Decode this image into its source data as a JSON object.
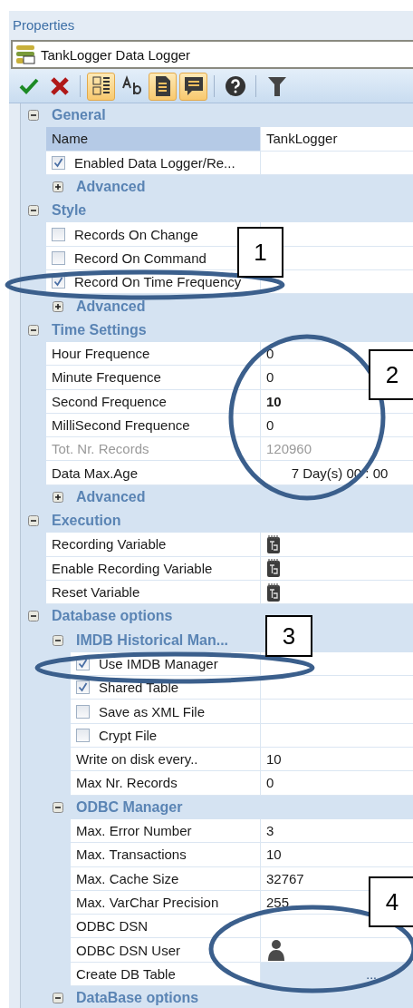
{
  "panel": {
    "title": "Properties"
  },
  "object_selector": {
    "value": "TankLogger Data Logger"
  },
  "toolbar": [
    {
      "kind": "apply",
      "selected": false
    },
    {
      "kind": "cancel",
      "selected": false
    },
    {
      "kind": "separator"
    },
    {
      "kind": "categorized",
      "selected": true
    },
    {
      "kind": "alphabetical",
      "selected": false
    },
    {
      "kind": "pages",
      "selected": true
    },
    {
      "kind": "comments",
      "selected": true
    },
    {
      "kind": "separator"
    },
    {
      "kind": "help",
      "selected": false
    },
    {
      "kind": "separator"
    },
    {
      "kind": "filter",
      "selected": false
    }
  ],
  "grid": [
    {
      "kind": "group",
      "label": "General",
      "expanded": true,
      "children": [
        {
          "kind": "text",
          "label": "Name",
          "value": "TankLogger",
          "selected": true,
          "disabled": false
        },
        {
          "kind": "check",
          "label": "Enabled Data Logger/Re...",
          "checked": true
        },
        {
          "kind": "group",
          "label": "Advanced",
          "expanded": false
        }
      ]
    },
    {
      "kind": "group",
      "label": "Style",
      "expanded": true,
      "children": [
        {
          "kind": "check",
          "label": "Records On Change",
          "checked": false
        },
        {
          "kind": "check",
          "label": "Record On Command",
          "checked": false
        },
        {
          "kind": "check",
          "label": "Record On Time Frequency",
          "checked": true
        },
        {
          "kind": "group",
          "label": "Advanced",
          "expanded": false
        }
      ]
    },
    {
      "kind": "group",
      "label": "Time Settings",
      "expanded": true,
      "children": [
        {
          "kind": "text",
          "label": "Hour Frequence",
          "value": "0",
          "selected": false,
          "disabled": false
        },
        {
          "kind": "text",
          "label": "Minute Frequence",
          "value": "0",
          "selected": false,
          "disabled": false
        },
        {
          "kind": "text",
          "label": "Second Frequence",
          "value": "10",
          "selected": false,
          "disabled": false,
          "modified": true
        },
        {
          "kind": "text",
          "label": "MilliSecond Frequence",
          "value": "0",
          "selected": false,
          "disabled": false
        },
        {
          "kind": "text",
          "label": "Tot. Nr. Records",
          "value": "120960",
          "selected": false,
          "disabled": true
        },
        {
          "kind": "duration",
          "label": "Data Max.Age",
          "value": "7 Day(s) 00 : 00"
        },
        {
          "kind": "group",
          "label": "Advanced",
          "expanded": false
        }
      ]
    },
    {
      "kind": "group",
      "label": "Execution",
      "expanded": true,
      "children": [
        {
          "kind": "variable",
          "label": "Recording Variable"
        },
        {
          "kind": "variable",
          "label": "Enable Recording Variable"
        },
        {
          "kind": "variable",
          "label": "Reset Variable"
        }
      ]
    },
    {
      "kind": "group",
      "label": "Database options",
      "expanded": true,
      "children": [
        {
          "kind": "group",
          "label": "IMDB Historical Man...",
          "expanded": true,
          "children": [
            {
              "kind": "check",
              "label": "Use IMDB Manager",
              "checked": true
            },
            {
              "kind": "check",
              "label": "Shared Table",
              "checked": true
            },
            {
              "kind": "check",
              "label": "Save as XML File",
              "checked": false
            },
            {
              "kind": "check",
              "label": "Crypt File",
              "checked": false
            },
            {
              "kind": "text",
              "label": "Write on disk every..",
              "value": "10",
              "selected": false,
              "disabled": false
            },
            {
              "kind": "text",
              "label": "Max Nr. Records",
              "value": "0",
              "selected": false,
              "disabled": false
            }
          ]
        },
        {
          "kind": "group",
          "label": "ODBC Manager",
          "expanded": true,
          "children": [
            {
              "kind": "text",
              "label": "Max. Error Number",
              "value": "3",
              "selected": false,
              "disabled": false
            },
            {
              "kind": "text",
              "label": "Max. Transactions",
              "value": "10",
              "selected": false,
              "disabled": false
            },
            {
              "kind": "text",
              "label": "Max. Cache Size",
              "value": "32767",
              "selected": false,
              "disabled": false
            },
            {
              "kind": "text",
              "label": "Max. VarChar Precision",
              "value": "255",
              "selected": false,
              "disabled": false
            },
            {
              "kind": "text",
              "label": "ODBC DSN",
              "selected": false,
              "disabled": false
            },
            {
              "kind": "user",
              "label": "ODBC DSN User"
            },
            {
              "kind": "action",
              "label": "Create DB Table",
              "value": "..."
            }
          ]
        },
        {
          "kind": "group",
          "label": "DataBase options",
          "expanded": true
        }
      ]
    }
  ],
  "annotations": [
    {
      "label": "1"
    },
    {
      "label": "2"
    },
    {
      "label": "3"
    },
    {
      "label": "4"
    }
  ]
}
